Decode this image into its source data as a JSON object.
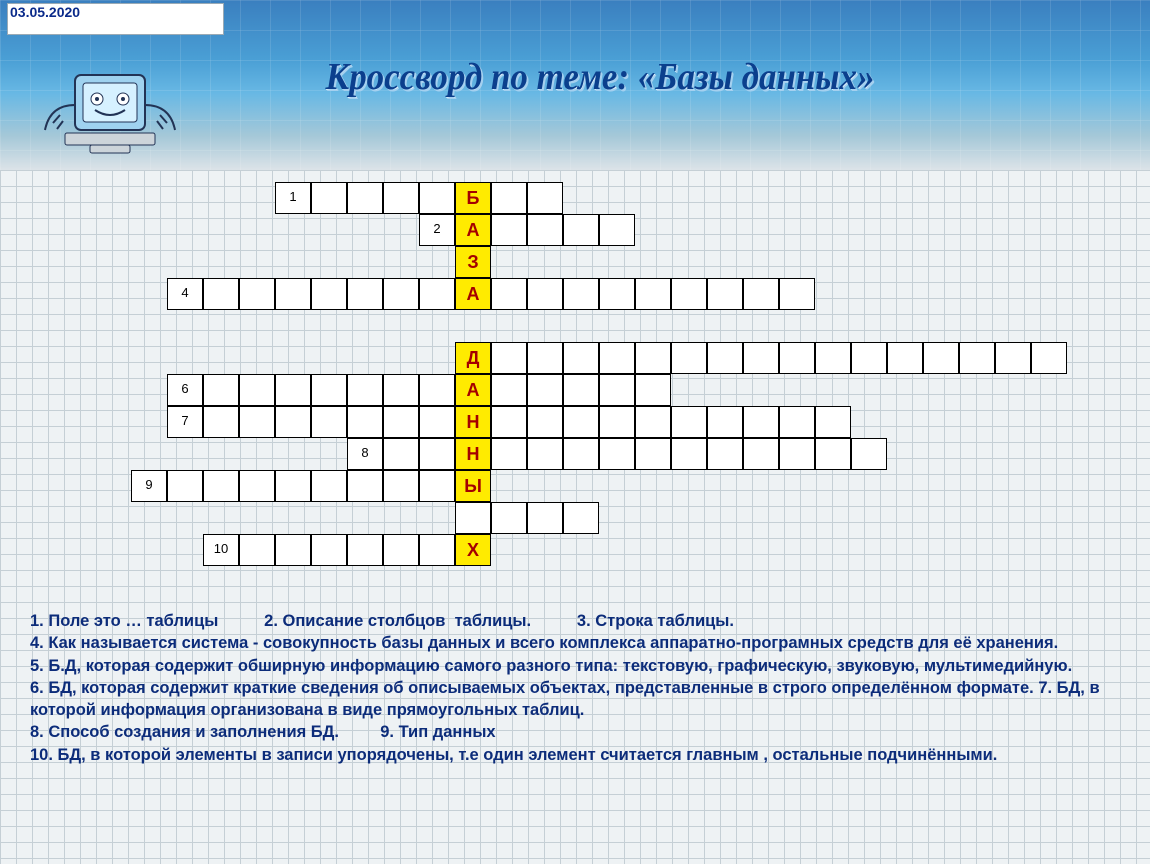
{
  "date": "03.05.2020",
  "title": "Кроссворд по теме: «Базы данных»",
  "key_letters": {
    "b": "Б",
    "a1": "А",
    "z": "З",
    "a2": "А",
    "d": "Д",
    "a3": "А",
    "n1": "Н",
    "n2": "Н",
    "y": "Ы",
    "x": "Х"
  },
  "row_nums": {
    "r1": "1",
    "r2": "2",
    "r4": "4",
    "r6": "6",
    "r7": "7",
    "r8": "8",
    "r9": "9",
    "r10": "10"
  },
  "clues": {
    "l1a": "1. Поле это … таблицы",
    "l1b": "2. Описание столбцов  таблицы.",
    "l1c": "3. Строка таблицы.",
    "l2": "4. Как называется система -   совокупность базы данных и всего комплекса аппаратно-програмных средств для её хранения.",
    "l3": "5. Б.Д, которая содержит обширную информацию самого разного типа: текстовую, графическую, звуковую, мультимедийную.",
    "l4": "6. БД, которая содержит краткие сведения об описываемых объектах, представленные в строго определённом формате.     7. БД, в которой информация организована в виде прямоугольных таблиц.",
    "l5": "8. Способ создания и заполнения БД.         9. Тип данных",
    "l6": "10. БД, в которой элементы в записи упорядочены, т.е один элемент считается  главным , остальные подчинёнными"
  }
}
